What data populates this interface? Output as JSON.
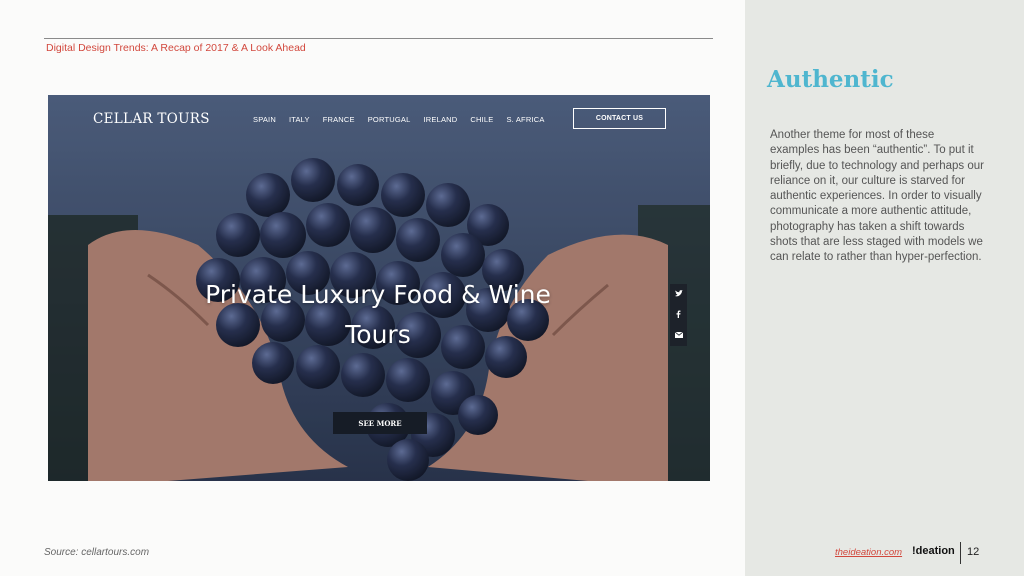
{
  "slide": {
    "header_title": "Digital Design Trends: A Recap of 2017 & A Look Ahead",
    "section_title": "Authentic",
    "body_text": "Another theme for most of these examples has been “authentic”. To put it briefly, due to technology and perhaps our reliance on it, our culture is starved for authentic experiences. In order to visually communicate a more authentic attitude, photography has taken a shift towards shots that are less staged with models we can relate to rather than hyper-perfection.",
    "source": "Source: cellartours.com",
    "site_link": "theideation.com",
    "logo": "!deation",
    "page_number": "12"
  },
  "website": {
    "brand": "CELLAR TOURS",
    "nav": [
      "SPAIN",
      "ITALY",
      "FRANCE",
      "PORTUGAL",
      "IRELAND",
      "CHILE",
      "S. AFRICA"
    ],
    "contact_label": "CONTACT US",
    "hero_title": "Private Luxury Food & Wine Tours",
    "see_more_label": "SEE MORE",
    "social_icons": [
      "twitter-icon",
      "facebook-icon",
      "mail-icon"
    ]
  },
  "colors": {
    "accent_red": "#d2483d",
    "title_blue": "#4fb6cf",
    "panel_grey": "#e6e8e4"
  }
}
